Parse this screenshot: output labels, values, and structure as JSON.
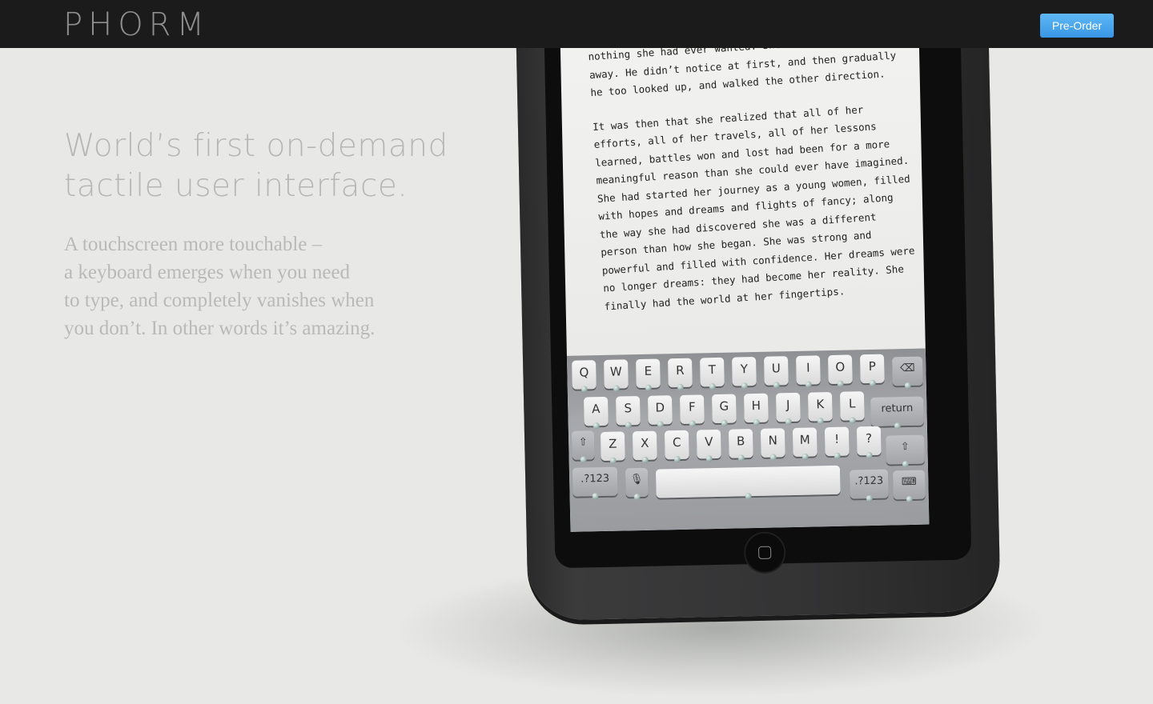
{
  "header": {
    "logo": "PHORM",
    "cta_label": "Pre-Order"
  },
  "hero": {
    "headline_line1": "World’s first on-demand",
    "headline_line2": "tactile user interface.",
    "body_lines": [
      "A touchscreen more touchable –",
      "a keyboard emerges when you need",
      "to type, and completely vanishes when",
      "you don’t. In other words it’s amazing."
    ]
  },
  "device": {
    "text_paragraph1": [
      "nothing she had ever wanted. She",
      "away. He didn’t notice at first, and then gradually",
      "he too looked up, and walked the other direction."
    ],
    "text_paragraph2": [
      "It was then that she realized that all of her",
      "efforts, all of her travels, all of her lessons",
      "learned, battles won and lost had been for a more",
      "meaningful reason than she could ever have imagined.",
      "She had started her journey as a young women, filled",
      "with hopes and dreams and flights of fancy; along",
      "the way she had discovered she was a different",
      "person than how she began. She was strong and",
      "powerful and filled with confidence. Her dreams were",
      "no longer dreams: they had become her reality. She",
      "finally had the world at her fingertips."
    ],
    "keyboard": {
      "row1": [
        "Q",
        "W",
        "E",
        "R",
        "T",
        "Y",
        "U",
        "I",
        "O",
        "P"
      ],
      "row2": [
        "A",
        "S",
        "D",
        "F",
        "G",
        "H",
        "J",
        "K",
        "L"
      ],
      "row3": [
        "Z",
        "X",
        "C",
        "V",
        "B",
        "N",
        "M",
        "!",
        "?"
      ],
      "return_label": "return",
      "numbers_label": ".?123",
      "numbers_label_left": ".?123",
      "mic_glyph": "🎙",
      "shift_glyph": "⇧",
      "delete_glyph": "⌫",
      "hide_glyph": "⌨"
    }
  },
  "colors": {
    "topbar": "#1c1b1c",
    "background": "#e8e9e6",
    "cta": "#3f9fe8",
    "headline": "#b6b7b4"
  }
}
